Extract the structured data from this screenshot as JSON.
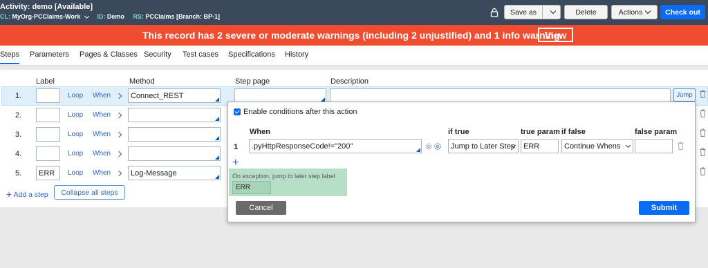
{
  "header": {
    "title": "Activity: demo [Available]",
    "meta": [
      {
        "key": "CL:",
        "value": "MyOrg-PCClaims-Work"
      },
      {
        "key": "ID:",
        "value": "Demo"
      },
      {
        "key": "RS:",
        "value": "PCClaims [Branch: BP-1]"
      }
    ],
    "buttons": {
      "save_as": "Save as",
      "delete": "Delete",
      "actions": "Actions",
      "check_out": "Check out"
    }
  },
  "warning": {
    "text": "This record has 2 severe or moderate warnings (including 2 unjustified) and 1 info warning",
    "view": "View"
  },
  "tabs": [
    "Steps",
    "Parameters",
    "Pages & Classes",
    "Security",
    "Test cases",
    "Specifications",
    "History"
  ],
  "active_tab": "Steps",
  "columns": {
    "label": "Label",
    "method": "Method",
    "step_page": "Step page",
    "description": "Description"
  },
  "steps": [
    {
      "num": "1.",
      "label": "",
      "loop": "Loop",
      "when": "When",
      "method": "Connect_REST"
    },
    {
      "num": "2.",
      "label": "",
      "loop": "Loop",
      "when": "When",
      "method": ""
    },
    {
      "num": "3.",
      "label": "",
      "loop": "Loop",
      "when": "When",
      "method": ""
    },
    {
      "num": "4.",
      "label": "",
      "loop": "Loop",
      "when": "When",
      "method": ""
    },
    {
      "num": "5.",
      "label": "ERR",
      "loop": "Loop",
      "when": "When",
      "method": "Log-Message"
    }
  ],
  "jump_label": "Jump",
  "add_step": "Add a step",
  "collapse_all": "Collapse all steps",
  "popover": {
    "enable_label": "Enable conditions after this action",
    "headers": {
      "when": "When",
      "if_true": "if true",
      "true_param": "true param",
      "if_false": "if false",
      "false_param": "false param"
    },
    "row": {
      "num": "1",
      "when": ".pyHttpResponseCode!=\"200\"",
      "if_true": "Jump to Later Step",
      "true_param": "ERR",
      "if_false": "Continue Whens",
      "false_param": ""
    },
    "add": "+",
    "exception_label": "On exception, jump to later step label",
    "exception_value": "ERR",
    "cancel": "Cancel",
    "submit": "Submit"
  },
  "colors": {
    "header_bg": "#3a4a5c",
    "warning_bg": "#ef4c30",
    "accent": "#0a6cf5",
    "row_highlight": "#dff0fb",
    "exception_bg": "#b7dfc7"
  }
}
